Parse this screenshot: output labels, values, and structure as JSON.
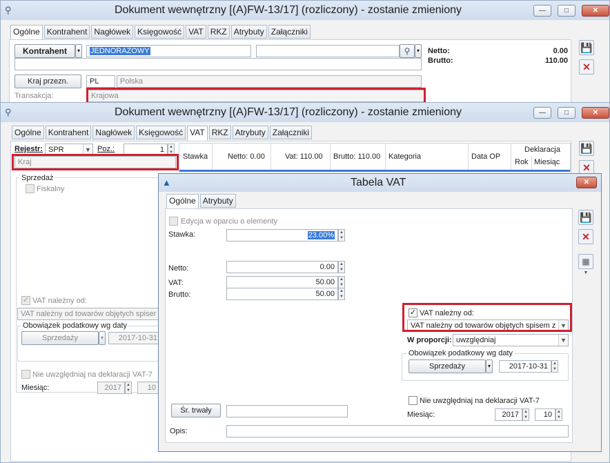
{
  "window1": {
    "title": "Dokument wewnętrzny [(A)FW-13/17] (rozliczony) - zostanie zmieniony",
    "tabs": [
      "Ogólne",
      "Kontrahent",
      "Nagłówek",
      "Księgowość",
      "VAT",
      "RKZ",
      "Atrybuty",
      "Załączniki"
    ],
    "contractor_button": "Kontrahent",
    "contractor_value": "JEDNORAZOWY",
    "netto_label": "Netto:",
    "netto_value": "0.00",
    "brutto_label": "Brutto:",
    "brutto_value": "110.00",
    "country_button": "Kraj przezn.",
    "country_code": "PL",
    "country_name": "Polska",
    "transaction_label": "Transakcja:",
    "transaction_value": "Krajowa"
  },
  "window2": {
    "title": "Dokument wewnętrzny [(A)FW-13/17] (rozliczony) - zostanie zmieniony",
    "tabs": [
      "Ogólne",
      "Kontrahent",
      "Nagłówek",
      "Księgowość",
      "VAT",
      "RKZ",
      "Atrybuty",
      "Załączniki"
    ],
    "register_label": "Rejestr:",
    "register_value": "SPR",
    "position_label": "Poz.:",
    "position_value": "1",
    "region_value": "Kraj",
    "table_headers": {
      "stawka": "Stawka",
      "netto": "Netto: 0.00",
      "vat": "Vat: 110.00",
      "brutto": "Brutto: 110.00",
      "kategoria": "Kategoria",
      "data_op": "Data OP",
      "deklaracja": "Deklaracja",
      "rok": "Rok",
      "miesiac": "Miesiąc"
    },
    "sales_group": "Sprzedaż",
    "fiscal_label": "Fiskalny",
    "vat_due_label": "VAT należny od:",
    "vat_due_value": "VAT należny od towarów objętych spiser",
    "tax_obligation_label": "Obowiązek podatkowy wg daty",
    "sales_button": "Sprzedaży",
    "date_value": "2017-10-31",
    "ignore_vat7_label": "Nie uwzględniaj na deklaracji VAT-7",
    "month_label": "Miesiąc:",
    "year_value": "2017",
    "month_value": "10"
  },
  "dialog": {
    "title": "Tabela VAT",
    "tabs": [
      "Ogólne",
      "Atrybuty"
    ],
    "edit_elements_label": "Edycja w oparciu o elementy",
    "stawka_label": "Stawka:",
    "stawka_value": "23.00%",
    "netto_label": "Netto:",
    "netto_value": "0.00",
    "vat_label": "VAT:",
    "vat_value": "50.00",
    "brutto_label": "Brutto:",
    "brutto_value": "50.00",
    "vat_due_label": "VAT należny od:",
    "vat_due_value": "VAT należny od towarów objętych spisem z",
    "proportion_label": "W proporcji:",
    "proportion_value": "uwzględniaj",
    "tax_obligation_label": "Obowiązek podatkowy wg daty",
    "sales_button": "Sprzedaży",
    "date_value": "2017-10-31",
    "ignore_vat7_label": "Nie uwzględniaj na deklaracji VAT-7",
    "month_label": "Miesiąc:",
    "year_value": "2017",
    "month_value": "10",
    "fixed_asset_button": "Śr. trwały",
    "opis_label": "Opis:"
  },
  "colors": {
    "highlight_red": "#d0202e",
    "selection_blue": "#3a7bd5",
    "close_red": "#c9533e"
  }
}
